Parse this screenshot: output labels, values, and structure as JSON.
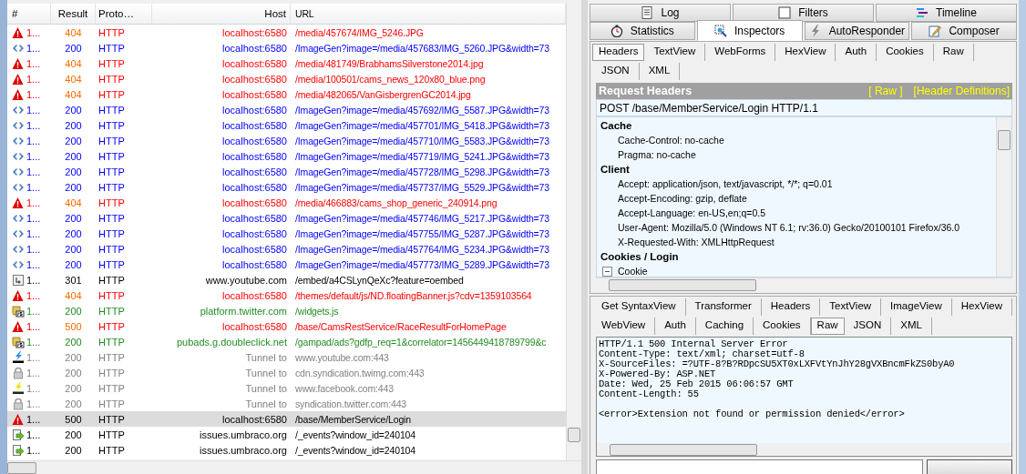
{
  "sessions": {
    "columns": [
      "#",
      "Result",
      "Proto…",
      "Host",
      "URL"
    ],
    "rows": [
      {
        "kind": "warning",
        "num": "1...",
        "result": "404",
        "protocol": "HTTP",
        "host": "localhost:6580",
        "url": "/media/457674/IMG_5246.JPG",
        "selected": false
      },
      {
        "kind": "image",
        "num": "1...",
        "result": "200",
        "protocol": "HTTP",
        "host": "localhost:6580",
        "url": "/ImageGen?image=/media/457683/IMG_5260.JPG&width=73",
        "selected": false
      },
      {
        "kind": "warning",
        "num": "1...",
        "result": "404",
        "protocol": "HTTP",
        "host": "localhost:6580",
        "url": "/media/481749/BrabhamsSilverstone2014.jpg",
        "selected": false
      },
      {
        "kind": "warning",
        "num": "1...",
        "result": "404",
        "protocol": "HTTP",
        "host": "localhost:6580",
        "url": "/media/100501/cams_news_120x80_blue.png",
        "selected": false
      },
      {
        "kind": "warning",
        "num": "1...",
        "result": "404",
        "protocol": "HTTP",
        "host": "localhost:6580",
        "url": "/media/482065/VanGisbergrenGC2014.jpg",
        "selected": false
      },
      {
        "kind": "image",
        "num": "1...",
        "result": "200",
        "protocol": "HTTP",
        "host": "localhost:6580",
        "url": "/ImageGen?image=/media/457692/IMG_5587.JPG&width=73",
        "selected": false
      },
      {
        "kind": "image",
        "num": "1...",
        "result": "200",
        "protocol": "HTTP",
        "host": "localhost:6580",
        "url": "/ImageGen?image=/media/457701/IMG_5418.JPG&width=73",
        "selected": false
      },
      {
        "kind": "image",
        "num": "1...",
        "result": "200",
        "protocol": "HTTP",
        "host": "localhost:6580",
        "url": "/ImageGen?image=/media/457710/IMG_5583.JPG&width=73",
        "selected": false
      },
      {
        "kind": "image",
        "num": "1...",
        "result": "200",
        "protocol": "HTTP",
        "host": "localhost:6580",
        "url": "/ImageGen?image=/media/457719/IMG_5241.JPG&width=73",
        "selected": false
      },
      {
        "kind": "image",
        "num": "1...",
        "result": "200",
        "protocol": "HTTP",
        "host": "localhost:6580",
        "url": "/ImageGen?image=/media/457728/IMG_5298.JPG&width=73",
        "selected": false
      },
      {
        "kind": "image",
        "num": "1...",
        "result": "200",
        "protocol": "HTTP",
        "host": "localhost:6580",
        "url": "/ImageGen?image=/media/457737/IMG_5529.JPG&width=73",
        "selected": false
      },
      {
        "kind": "warning",
        "num": "1...",
        "result": "404",
        "protocol": "HTTP",
        "host": "localhost:6580",
        "url": "/media/466883/cams_shop_generic_240914.png",
        "selected": false
      },
      {
        "kind": "image",
        "num": "1...",
        "result": "200",
        "protocol": "HTTP",
        "host": "localhost:6580",
        "url": "/ImageGen?image=/media/457746/IMG_5217.JPG&width=73",
        "selected": false
      },
      {
        "kind": "image",
        "num": "1...",
        "result": "200",
        "protocol": "HTTP",
        "host": "localhost:6580",
        "url": "/ImageGen?image=/media/457755/IMG_5287.JPG&width=73",
        "selected": false
      },
      {
        "kind": "image",
        "num": "1...",
        "result": "200",
        "protocol": "HTTP",
        "host": "localhost:6580",
        "url": "/ImageGen?image=/media/457764/IMG_5234.JPG&width=73",
        "selected": false
      },
      {
        "kind": "image",
        "num": "1...",
        "result": "200",
        "protocol": "HTTP",
        "host": "localhost:6580",
        "url": "/ImageGen?image=/media/457773/IMG_5289.JPG&width=73",
        "selected": false
      },
      {
        "kind": "redirect",
        "num": "1...",
        "result": "301",
        "protocol": "HTTP",
        "host": "www.youtube.com",
        "url": "/embed/a4CSLynQeXc?feature=oembed",
        "selected": false
      },
      {
        "kind": "warning",
        "num": "1...",
        "result": "404",
        "protocol": "HTTP",
        "host": "localhost:6580",
        "url": "/themes/default/js/ND.floatingBanner.js?cdv=1359103564",
        "selected": false
      },
      {
        "kind": "script",
        "num": "1...",
        "result": "200",
        "protocol": "HTTP",
        "host": "platform.twitter.com",
        "url": "/widgets.js",
        "selected": false
      },
      {
        "kind": "warning",
        "num": "1...",
        "result": "500",
        "protocol": "HTTP",
        "host": "localhost:6580",
        "url": "/base/CamsRestService/RaceResultForHomePage",
        "selected": false
      },
      {
        "kind": "script",
        "num": "1...",
        "result": "200",
        "protocol": "HTTP",
        "host": "pubads.g.doubleclick.net",
        "url": "/gampad/ads?gdfp_req=1&correlator=1456449418789799&c",
        "selected": false
      },
      {
        "kind": "http2",
        "num": "1...",
        "result": "200",
        "protocol": "HTTP",
        "host": "Tunnel to",
        "url": "www.youtube.com:443",
        "selected": false
      },
      {
        "kind": "lock",
        "num": "1...",
        "result": "200",
        "protocol": "HTTP",
        "host": "Tunnel to",
        "url": "cdn.syndication.twimg.com:443",
        "selected": false
      },
      {
        "kind": "spdy",
        "num": "1...",
        "result": "200",
        "protocol": "HTTP",
        "host": "Tunnel to",
        "url": "www.facebook.com:443",
        "selected": false
      },
      {
        "kind": "lock",
        "num": "1...",
        "result": "200",
        "protocol": "HTTP",
        "host": "Tunnel to",
        "url": "syndication.twitter.com:443",
        "selected": false
      },
      {
        "kind": "warning",
        "num": "1...",
        "result": "500",
        "protocol": "HTTP",
        "host": "localhost:6580",
        "url": "/base/MemberService/Login",
        "selected": true
      },
      {
        "kind": "download",
        "num": "1...",
        "result": "200",
        "protocol": "HTTP",
        "host": "issues.umbraco.org",
        "url": "/_events?window_id=240104",
        "selected": false
      },
      {
        "kind": "download",
        "num": "1...",
        "result": "200",
        "protocol": "HTTP",
        "host": "issues.umbraco.org",
        "url": "/_events?window_id=240104",
        "selected": false
      }
    ]
  },
  "main_tabs": [
    [
      {
        "label": "Log",
        "kind": "log",
        "selected": false
      },
      {
        "label": "Filters",
        "kind": "filters",
        "selected": false
      },
      {
        "label": "Timeline",
        "kind": "timeline",
        "selected": false
      }
    ],
    [
      {
        "label": "Statistics",
        "kind": "stopwatch",
        "selected": false
      },
      {
        "label": "Inspectors",
        "kind": "inspect",
        "selected": true
      },
      {
        "label": "AutoResponder",
        "kind": "bolt",
        "selected": false
      },
      {
        "label": "Composer",
        "kind": "compose",
        "selected": false
      }
    ]
  ],
  "request": {
    "tabs": [
      [
        {
          "label": "Headers",
          "selected": true
        },
        {
          "label": "TextView",
          "selected": false
        },
        {
          "label": "WebForms",
          "selected": false
        },
        {
          "label": "HexView",
          "selected": false
        },
        {
          "label": "Auth",
          "selected": false
        },
        {
          "label": "Cookies",
          "selected": false
        },
        {
          "label": "Raw",
          "selected": false
        }
      ],
      [
        {
          "label": "JSON",
          "selected": false
        },
        {
          "label": "XML",
          "selected": false
        }
      ]
    ],
    "title": "Request Headers",
    "links": [
      "[ Raw ]",
      "[Header Definitions]"
    ],
    "request_line": "POST /base/MemberService/Login HTTP/1.1",
    "groups": [
      {
        "label": "Cache",
        "children": [
          {
            "label": "Cache-Control: no-cache"
          },
          {
            "label": "Pragma: no-cache"
          }
        ]
      },
      {
        "label": "Client",
        "children": [
          {
            "label": "Accept: application/json, text/javascript, */*; q=0.01"
          },
          {
            "label": "Accept-Encoding: gzip, deflate"
          },
          {
            "label": "Accept-Language: en-US,en;q=0.5"
          },
          {
            "label": "User-Agent: Mozilla/5.0 (Windows NT 6.1; rv:36.0) Gecko/20100101 Firefox/36.0"
          },
          {
            "label": "X-Requested-With: XMLHttpRequest"
          }
        ]
      },
      {
        "label": "Cookies / Login",
        "children": [
          {
            "label": "Cookie",
            "expanded": true
          }
        ]
      }
    ]
  },
  "response": {
    "tabs": [
      [
        {
          "label": "Get SyntaxView",
          "selected": false
        },
        {
          "label": "Transformer",
          "selected": false
        },
        {
          "label": "Headers",
          "selected": false
        },
        {
          "label": "TextView",
          "selected": false
        },
        {
          "label": "ImageView",
          "selected": false
        },
        {
          "label": "HexView",
          "selected": false
        }
      ],
      [
        {
          "label": "WebView",
          "selected": false
        },
        {
          "label": "Auth",
          "selected": false
        },
        {
          "label": "Caching",
          "selected": false
        },
        {
          "label": "Cookies",
          "selected": false
        },
        {
          "label": "Raw",
          "selected": true
        },
        {
          "label": "JSON",
          "selected": false
        },
        {
          "label": "XML",
          "selected": false
        }
      ]
    ],
    "raw_headers": [
      "HTTP/1.1 500 Internal Server Error",
      "Content-Type: text/xml; charset=utf-8",
      "X-SourceFiles: =?UTF-8?B?RDpcSU5XT0xLXFVtYnJhY28gVXBncmFkZS0byA0",
      "X-Powered-By: ASP.NET",
      "Date: Wed, 25 Feb 2015 06:06:57 GMT",
      "Content-Length: 55"
    ],
    "raw_body": "<error>Extension not found or permission denied</error>"
  }
}
